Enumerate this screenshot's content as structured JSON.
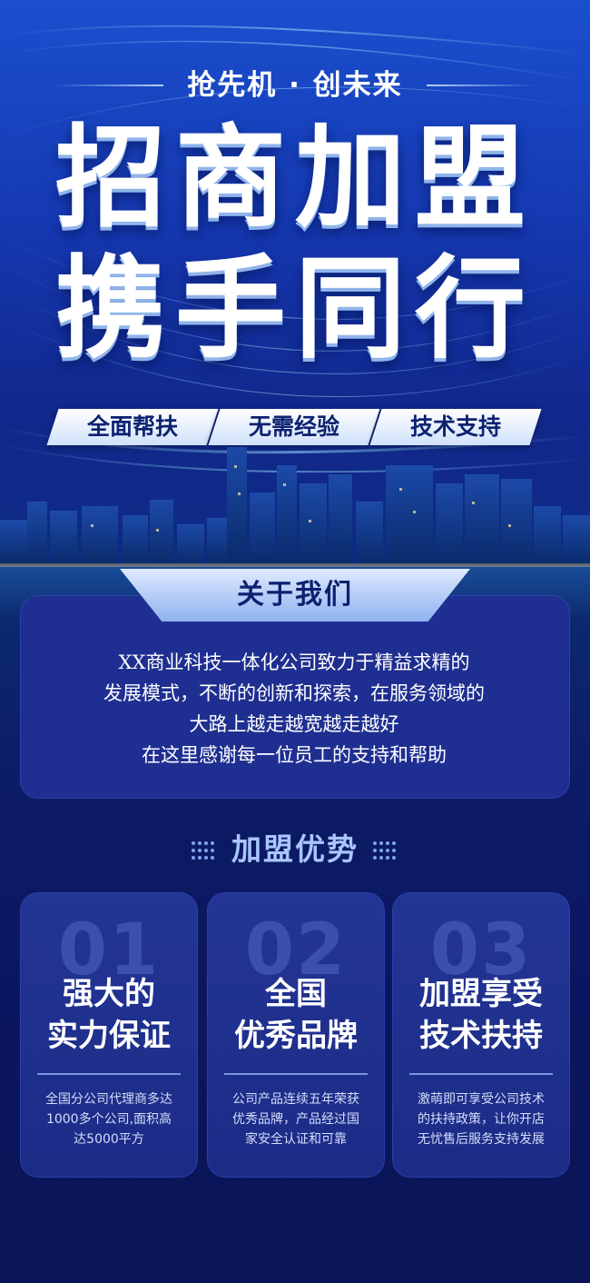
{
  "hero": {
    "tagline": "抢先机 · 创未来",
    "headline_line1": "招商加盟",
    "headline_line2": "携手同行",
    "features": [
      "全面帮扶",
      "无需经验",
      "技术支持"
    ]
  },
  "about": {
    "title": "关于我们",
    "lines": [
      "XX商业科技一体化公司致力于精益求精的",
      "发展模式，不断的创新和探索，在服务领域的",
      "大路上越走越宽越走越好",
      "在这里感谢每一位员工的支持和帮助"
    ]
  },
  "advantages": {
    "title": "加盟优势",
    "cards": [
      {
        "number": "01",
        "title_lines": [
          "强大的",
          "实力保证"
        ],
        "desc_lines": [
          "全国分公司代理商多达",
          "1000多个公司,面积高",
          "达5000平方"
        ]
      },
      {
        "number": "02",
        "title_lines": [
          "全国",
          "优秀品牌"
        ],
        "desc_lines": [
          "公司产品连续五年荣获",
          "优秀品牌，产品经过国",
          "家安全认证和可靠"
        ]
      },
      {
        "number": "03",
        "title_lines": [
          "加盟享受",
          "技术扶持"
        ],
        "desc_lines": [
          "激萌即可享受公司技术",
          "的扶持政策，让你开店",
          "无忧售后服务支持发展"
        ]
      }
    ]
  },
  "colors": {
    "background_top": "#1b4fcf",
    "background_bottom": "#0a1456",
    "card": "#1f2f91",
    "accent_light": "#cfe1fb",
    "text_dark": "#0d2270"
  }
}
